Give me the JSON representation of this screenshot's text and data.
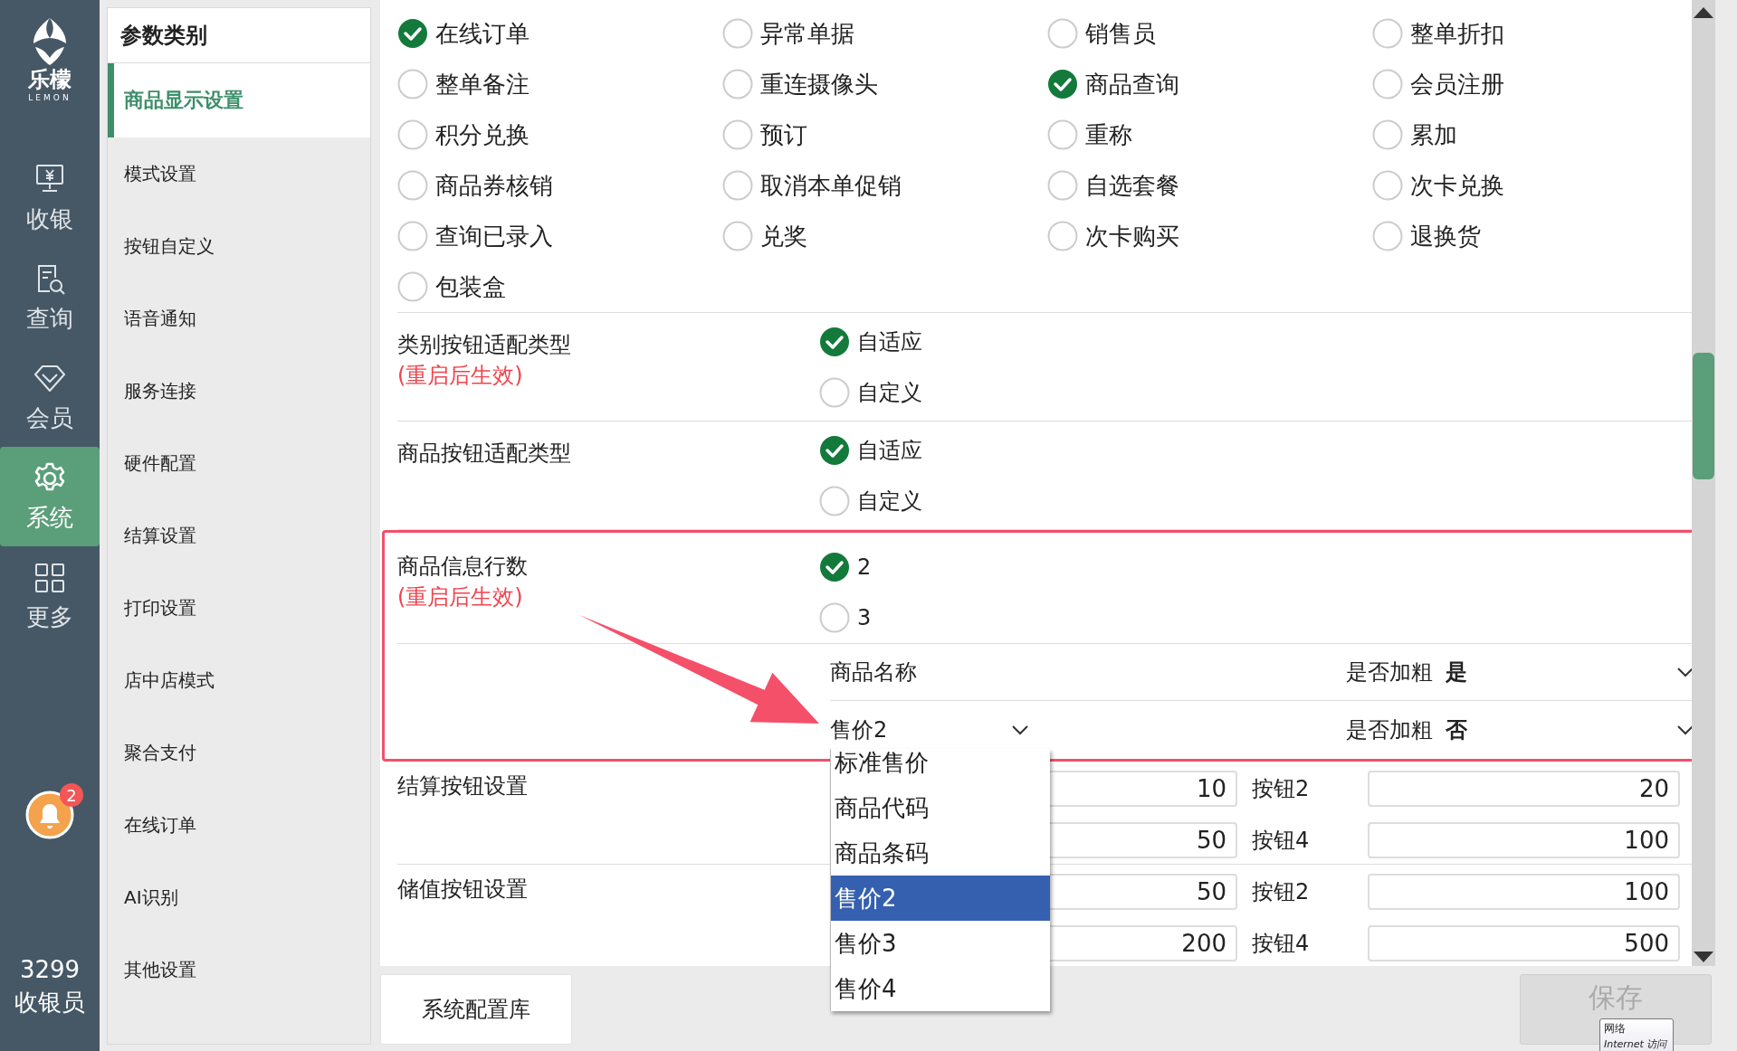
{
  "nav": {
    "logo_text": "乐檬",
    "logo_subtext": "LEMON",
    "items": [
      {
        "label": "收银",
        "kind": "register",
        "selected": false
      },
      {
        "label": "查询",
        "kind": "query",
        "selected": false
      },
      {
        "label": "会员",
        "kind": "member",
        "selected": false
      },
      {
        "label": "系统",
        "kind": "system",
        "selected": true
      },
      {
        "label": "更多",
        "kind": "more",
        "selected": false
      }
    ],
    "notification_count": "2",
    "user_id": "3299",
    "user_role": "收银员"
  },
  "categories": {
    "title": "参数类别",
    "items": [
      {
        "label": "商品显示设置",
        "selected": true
      },
      {
        "label": "模式设置",
        "selected": false
      },
      {
        "label": "按钮自定义",
        "selected": false
      },
      {
        "label": "语音通知",
        "selected": false
      },
      {
        "label": "服务连接",
        "selected": false
      },
      {
        "label": "硬件配置",
        "selected": false
      },
      {
        "label": "结算设置",
        "selected": false
      },
      {
        "label": "打印设置",
        "selected": false
      },
      {
        "label": "店中店模式",
        "selected": false
      },
      {
        "label": "聚合支付",
        "selected": false
      },
      {
        "label": "在线订单",
        "selected": false
      },
      {
        "label": "AI识别",
        "selected": false
      },
      {
        "label": "其他设置",
        "selected": false
      }
    ]
  },
  "options": [
    {
      "label": "在线订单",
      "checked": true
    },
    {
      "label": "异常单据",
      "checked": false
    },
    {
      "label": "销售员",
      "checked": false
    },
    {
      "label": "整单折扣",
      "checked": false
    },
    {
      "label": "整单备注",
      "checked": false
    },
    {
      "label": "重连摄像头",
      "checked": false
    },
    {
      "label": "商品查询",
      "checked": true
    },
    {
      "label": "会员注册",
      "checked": false
    },
    {
      "label": "积分兑换",
      "checked": false
    },
    {
      "label": "预订",
      "checked": false
    },
    {
      "label": "重称",
      "checked": false
    },
    {
      "label": "累加",
      "checked": false
    },
    {
      "label": "商品券核销",
      "checked": false
    },
    {
      "label": "取消本单促销",
      "checked": false
    },
    {
      "label": "自选套餐",
      "checked": false
    },
    {
      "label": "次卡兑换",
      "checked": false
    },
    {
      "label": "查询已录入",
      "checked": false
    },
    {
      "label": "兑奖",
      "checked": false
    },
    {
      "label": "次卡购买",
      "checked": false
    },
    {
      "label": "退换货",
      "checked": false
    },
    {
      "label": "包装盒",
      "checked": false
    }
  ],
  "settings": [
    {
      "label": "类别按钮适配类型",
      "note": "(重启后生效)",
      "highlighted": false,
      "choices": [
        {
          "label": "自适应",
          "selected": true
        },
        {
          "label": "自定义",
          "selected": false
        }
      ]
    },
    {
      "label": "商品按钮适配类型",
      "highlighted": false,
      "choices": [
        {
          "label": "自适应",
          "selected": true
        },
        {
          "label": "自定义",
          "selected": false
        }
      ]
    },
    {
      "label": "商品信息行数",
      "note": "(重启后生效)",
      "highlighted": true,
      "choices": [
        {
          "label": "2",
          "selected": true
        },
        {
          "label": "3",
          "selected": false
        }
      ],
      "lines": [
        {
          "field": "商品名称",
          "kind": "text",
          "bold_label": "是否加粗",
          "bold_value": "是"
        },
        {
          "field": "售价2",
          "kind": "select",
          "bold_label": "是否加粗",
          "bold_value": "否"
        }
      ]
    }
  ],
  "dropdown": {
    "options": [
      {
        "label": "标准售价",
        "selected": false
      },
      {
        "label": "商品代码",
        "selected": false
      },
      {
        "label": "商品条码",
        "selected": false
      },
      {
        "label": "售价2",
        "selected": true
      },
      {
        "label": "售价3",
        "selected": false
      },
      {
        "label": "售价4",
        "selected": false
      }
    ]
  },
  "button_settings": [
    {
      "label": "结算按钮设置",
      "rows": [
        [
          {
            "value": "10"
          },
          {
            "label": "按钮2",
            "value": "20"
          }
        ],
        [
          {
            "value": "50"
          },
          {
            "label": "按钮4",
            "value": "100"
          }
        ]
      ]
    },
    {
      "label": "储值按钮设置",
      "rows": [
        [
          {
            "value": "50"
          },
          {
            "label": "按钮2",
            "value": "100"
          }
        ],
        [
          {
            "value": "200"
          },
          {
            "label": "按钮4",
            "value": "500"
          }
        ]
      ]
    }
  ],
  "footer": {
    "library_button": "系统配置库",
    "save_button": {
      "label": "保存",
      "disabled": true
    }
  },
  "tooltip": {
    "title": "网络",
    "text": "Internet 访问"
  }
}
